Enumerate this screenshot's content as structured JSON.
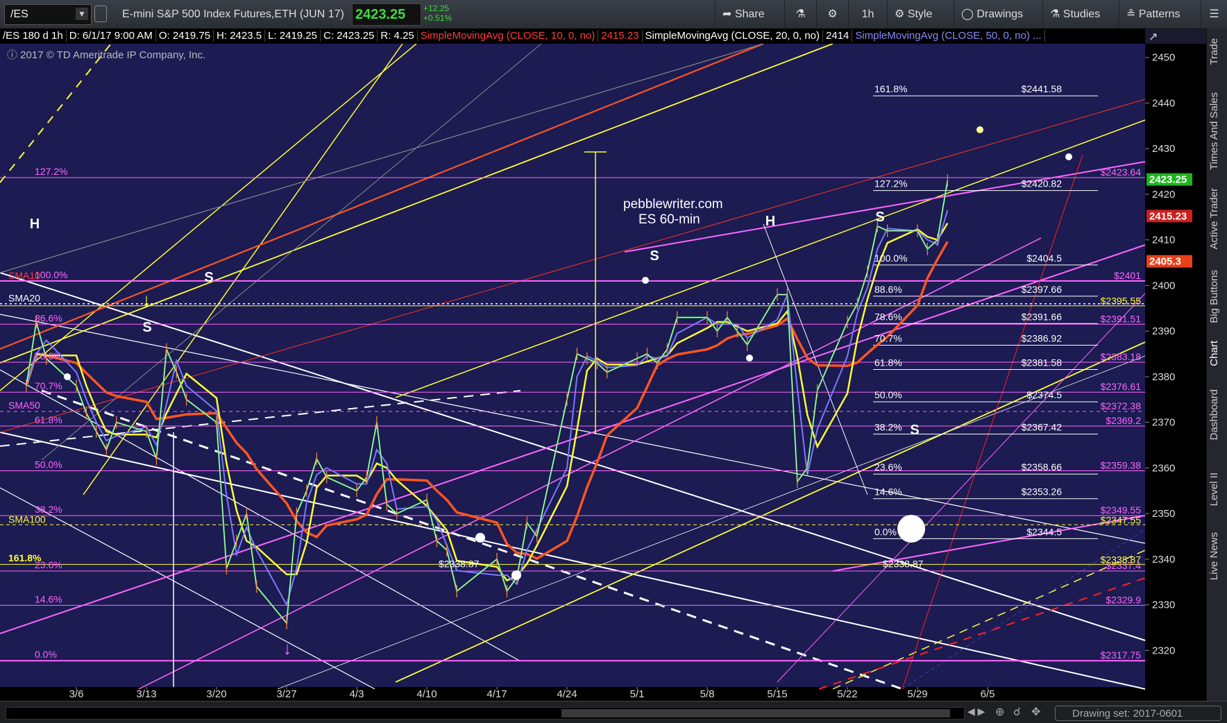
{
  "toolbar": {
    "symbol": "/ES",
    "description": "E-mini S&P 500 Index Futures,ETH (JUN 17)",
    "last_price": "2423.25",
    "change": "+12.25",
    "change_pct": "+0.51%",
    "share_label": "Share",
    "timeframe_label": "1h",
    "style_label": "Style",
    "drawings_label": "Drawings",
    "studies_label": "Studies",
    "patterns_label": "Patterns"
  },
  "infobar": {
    "symbol_period": "/ES 180 d 1h",
    "date": "D: 6/1/17 9:00 AM",
    "open": "O: 2419.75",
    "high": "H: 2423.5",
    "low": "L: 2419.25",
    "close": "C: 2423.25",
    "range": "R: 4.25",
    "sma10_label": "SimpleMovingAvg (CLOSE, 10, 0, no)",
    "sma10_value": "2415.23",
    "sma20_label": "SimpleMovingAvg (CLOSE, 20, 0, no)",
    "sma20_value": "2414",
    "sma50_label": "SimpleMovingAvg (CLOSE, 50, 0, no) ..."
  },
  "copyright": "2017 © TD Ameritrade IP Company, Inc.",
  "sidebar_tabs": [
    "Trade",
    "Times And Sales",
    "Active Trader",
    "Big Buttons",
    "Chart",
    "Dashboard",
    "Level II",
    "Live News"
  ],
  "bottombar": {
    "drawing_set": "Drawing set: 2017-0601"
  },
  "annotations": {
    "site": "pebblewriter.com",
    "subtitle": "ES 60-min",
    "h1": "H",
    "s1": "S",
    "s2": "S",
    "s3": "S",
    "h2": "H",
    "s4": "S",
    "s5": "S"
  },
  "chart_data": {
    "type": "candlestick",
    "x_ticks": [
      "3/6",
      "3/13",
      "3/20",
      "3/27",
      "4/3",
      "4/10",
      "4/17",
      "4/24",
      "5/1",
      "5/8",
      "5/15",
      "5/22",
      "5/29",
      "6/5"
    ],
    "y_ticks": [
      2320,
      2330,
      2340,
      2350,
      2360,
      2370,
      2380,
      2390,
      2400,
      2410,
      2420,
      2430,
      2440,
      2450
    ],
    "ylim": [
      2312,
      2453
    ],
    "price_markers": [
      {
        "label": "2423.25",
        "color": "#1db31d"
      },
      {
        "label": "2415.23",
        "color": "#cc1f1f"
      },
      {
        "label": "2405.3",
        "color": "#e8401a"
      }
    ],
    "sma_left_labels": [
      {
        "text": "SMA10",
        "price": 2401,
        "color": "#ff3b3b"
      },
      {
        "text": "SMA20",
        "price": 2396,
        "color": "#ffffff"
      },
      {
        "text": "SMA50",
        "price": 2372.5,
        "color": "#ff66ff"
      },
      {
        "text": "SMA100",
        "price": 2347.5,
        "color": "#ffff33"
      }
    ],
    "fib_left": [
      {
        "text": "127.2%",
        "price": 2423.64
      },
      {
        "text": "100.0%",
        "price": 2401
      },
      {
        "text": "86.6%",
        "price": 2391.51
      },
      {
        "text": "78.6%",
        "price": 2383.18
      },
      {
        "text": "70.7%",
        "price": 2376.61
      },
      {
        "text": "61.8%",
        "price": 2369.2
      },
      {
        "text": "50.0%",
        "price": 2359.38
      },
      {
        "text": "38.2%",
        "price": 2349.55
      },
      {
        "text": "23.6%",
        "price": 2337.4
      },
      {
        "text": "14.6%",
        "price": 2329.9
      },
      {
        "text": "0.0%",
        "price": 2317.75
      }
    ],
    "fib_right_magenta": [
      {
        "text": "$2423.64",
        "price": 2423.64
      },
      {
        "text": "$2401",
        "price": 2401
      },
      {
        "text": "$2391.51",
        "price": 2391.51
      },
      {
        "text": "$2383.18",
        "price": 2383.18
      },
      {
        "text": "$2376.61",
        "price": 2376.61
      },
      {
        "text": "$2372.38",
        "price": 2372.38
      },
      {
        "text": "$2369.2",
        "price": 2369.2
      },
      {
        "text": "$2359.38",
        "price": 2359.38
      },
      {
        "text": "$2349.55",
        "price": 2349.55
      },
      {
        "text": "$2337.4",
        "price": 2337.4
      },
      {
        "text": "$2329.9",
        "price": 2329.9
      },
      {
        "text": "$2317.75",
        "price": 2317.75
      }
    ],
    "fib_right_yellow": [
      {
        "text": "$2395.55",
        "price": 2395.55
      },
      {
        "text": "$2347.55",
        "price": 2347.55
      },
      {
        "text": "$2338.87",
        "price": 2338.87
      }
    ],
    "fib_white": [
      {
        "pct": "161.8%",
        "text": "$2441.58",
        "price": 2441.58
      },
      {
        "pct": "127.2%",
        "text": "$2420.82",
        "price": 2420.82
      },
      {
        "pct": "100.0%",
        "text": "$2404.5",
        "price": 2404.5
      },
      {
        "pct": "88.6%",
        "text": "$2397.66",
        "price": 2397.66
      },
      {
        "pct": "78.6%",
        "text": "$2391.66",
        "price": 2391.66
      },
      {
        "pct": "70.7%",
        "text": "$2386.92",
        "price": 2386.92
      },
      {
        "pct": "61.8%",
        "text": "$2381.58",
        "price": 2381.58
      },
      {
        "pct": "50.0%",
        "text": "$2374.5",
        "price": 2374.5
      },
      {
        "pct": "38.2%",
        "text": "$2367.42",
        "price": 2367.42
      },
      {
        "pct": "23.6%",
        "text": "$2358.66",
        "price": 2358.66
      },
      {
        "pct": "14.6%",
        "text": "$2353.26",
        "price": 2353.26
      },
      {
        "pct": "0.0%",
        "text": "$2344.5",
        "price": 2344.5
      }
    ],
    "misc_labels": [
      "161.8%",
      "$2338.87",
      "$2338.87"
    ],
    "series": [
      {
        "name": "price",
        "points": [
          [
            "3/1",
            2378
          ],
          [
            "3/2",
            2392
          ],
          [
            "3/3",
            2384
          ],
          [
            "3/6",
            2378
          ],
          [
            "3/7",
            2372
          ],
          [
            "3/8",
            2368
          ],
          [
            "3/9",
            2364
          ],
          [
            "3/10",
            2370
          ],
          [
            "3/13",
            2368
          ],
          [
            "3/14",
            2362
          ],
          [
            "3/15",
            2386
          ],
          [
            "3/16",
            2381
          ],
          [
            "3/17",
            2375
          ],
          [
            "3/20",
            2370
          ],
          [
            "3/21",
            2338
          ],
          [
            "3/22",
            2344
          ],
          [
            "3/23",
            2350
          ],
          [
            "3/24",
            2334
          ],
          [
            "3/27",
            2326
          ],
          [
            "3/28",
            2350
          ],
          [
            "3/29",
            2355
          ],
          [
            "3/30",
            2362
          ],
          [
            "3/31",
            2358
          ],
          [
            "4/3",
            2355
          ],
          [
            "4/4",
            2358
          ],
          [
            "4/5",
            2370
          ],
          [
            "4/6",
            2352
          ],
          [
            "4/7",
            2350
          ],
          [
            "4/10",
            2353
          ],
          [
            "4/11",
            2344
          ],
          [
            "4/12",
            2342
          ],
          [
            "4/13",
            2333
          ],
          [
            "4/17",
            2340
          ],
          [
            "4/18",
            2333
          ],
          [
            "4/19",
            2336
          ],
          [
            "4/20",
            2348
          ],
          [
            "4/21",
            2345
          ],
          [
            "4/24",
            2375
          ],
          [
            "4/25",
            2385
          ],
          [
            "4/26",
            2384
          ],
          [
            "4/27",
            2383
          ],
          [
            "4/28",
            2381
          ],
          [
            "5/1",
            2384
          ],
          [
            "5/2",
            2385
          ],
          [
            "5/3",
            2383
          ],
          [
            "5/4",
            2386
          ],
          [
            "5/5",
            2393
          ],
          [
            "5/8",
            2393
          ],
          [
            "5/9",
            2390
          ],
          [
            "5/10",
            2393
          ],
          [
            "5/11",
            2390
          ],
          [
            "5/12",
            2387
          ],
          [
            "5/15",
            2398
          ],
          [
            "5/16",
            2398
          ],
          [
            "5/17",
            2357
          ],
          [
            "5/18",
            2360
          ],
          [
            "5/19",
            2377
          ],
          [
            "5/22",
            2392
          ],
          [
            "5/23",
            2396
          ],
          [
            "5/24",
            2403
          ],
          [
            "5/25",
            2413
          ],
          [
            "5/26",
            2412
          ],
          [
            "5/29",
            2412
          ],
          [
            "5/30",
            2408
          ],
          [
            "5/31",
            2410
          ],
          [
            "6/1",
            2423
          ]
        ]
      }
    ]
  }
}
